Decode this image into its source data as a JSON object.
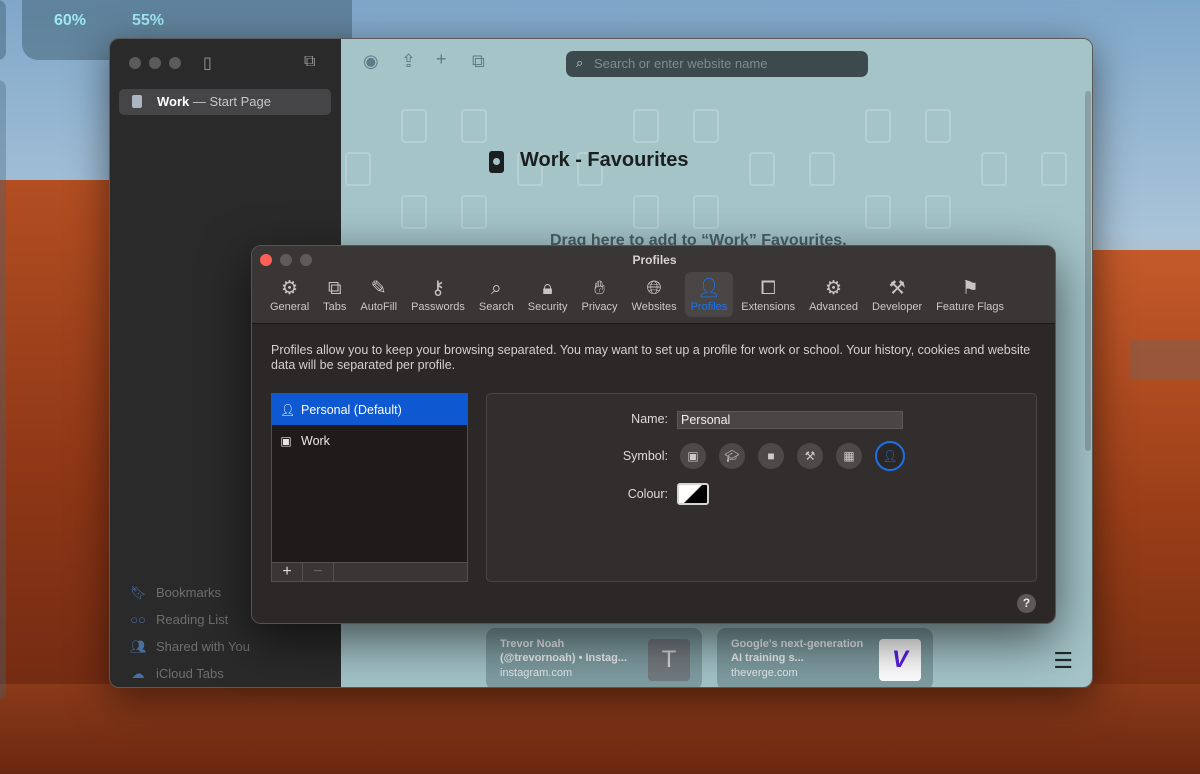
{
  "desktop": {
    "widget_values": [
      "60%",
      "55%"
    ]
  },
  "safari": {
    "sidebar": {
      "active_tab": {
        "profile": "Work",
        "separator": " — ",
        "title": "Start Page"
      },
      "links": [
        {
          "label": "Bookmarks",
          "icon": "bookmark-icon"
        },
        {
          "label": "Reading List",
          "icon": "reading-list-icon"
        },
        {
          "label": "Shared with You",
          "icon": "shared-icon"
        },
        {
          "label": "iCloud Tabs",
          "icon": "cloud-icon"
        }
      ]
    },
    "address_bar": {
      "placeholder": "Search or enter website name"
    },
    "start_page": {
      "title": "Work - Favourites",
      "drag_hint": "Drag here to add to “Work” Favourites."
    },
    "cards": [
      {
        "title": "Trevor Noah (@trevornoah) • Instag...",
        "domain": "instagram.com",
        "thumb": "T"
      },
      {
        "title": "Google's next-generation AI training s...",
        "domain": "theverge.com",
        "thumb": "V"
      }
    ]
  },
  "dialog": {
    "title": "Profiles",
    "tabs": [
      {
        "label": "General",
        "icon": "gear-icon"
      },
      {
        "label": "Tabs",
        "icon": "tabs-icon"
      },
      {
        "label": "AutoFill",
        "icon": "autofill-icon"
      },
      {
        "label": "Passwords",
        "icon": "key-icon"
      },
      {
        "label": "Search",
        "icon": "search-icon"
      },
      {
        "label": "Security",
        "icon": "lock-icon"
      },
      {
        "label": "Privacy",
        "icon": "hand-icon"
      },
      {
        "label": "Websites",
        "icon": "globe-icon"
      },
      {
        "label": "Profiles",
        "icon": "person-icon",
        "active": true
      },
      {
        "label": "Extensions",
        "icon": "puzzle-icon"
      },
      {
        "label": "Advanced",
        "icon": "gears-icon"
      },
      {
        "label": "Developer",
        "icon": "tools-icon"
      },
      {
        "label": "Feature Flags",
        "icon": "flags-icon"
      }
    ],
    "description": "Profiles allow you to keep your browsing separated. You may want to set up a profile for work or school. Your history, cookies and website data will be separated per profile.",
    "profiles": [
      {
        "label": "Personal (Default)",
        "selected": true,
        "icon": "person-icon"
      },
      {
        "label": "Work",
        "selected": false,
        "icon": "badge-icon"
      }
    ],
    "list_buttons": {
      "add": "+",
      "remove": "−"
    },
    "detail": {
      "name_label": "Name:",
      "name_value": "Personal",
      "symbol_label": "Symbol:",
      "colour_label": "Colour:",
      "symbols": [
        "badge-icon",
        "graduation-cap-icon",
        "briefcase-icon",
        "hammer-icon",
        "building-icon",
        "person-icon"
      ],
      "selected_symbol": "person-icon"
    },
    "help": "?"
  },
  "colors": {
    "accent": "#1b74ec",
    "selection": "#0e58d1",
    "close": "#fe5f57"
  }
}
